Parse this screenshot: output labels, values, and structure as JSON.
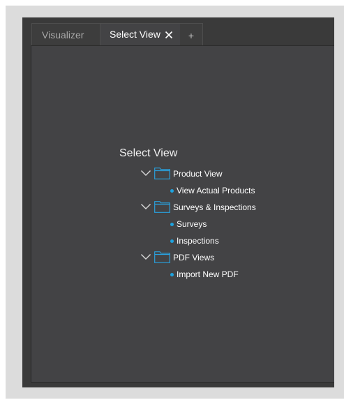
{
  "tabs": [
    {
      "label": "Visualizer",
      "active": false
    },
    {
      "label": "Select View",
      "active": true,
      "closable": true
    }
  ],
  "add_tab_label": "+",
  "panel": {
    "title": "Select View",
    "groups": [
      {
        "label": "Product View",
        "expanded": true,
        "icon": "folder-icon",
        "items": [
          "View Actual Products"
        ]
      },
      {
        "label": "Surveys & Inspections",
        "expanded": true,
        "icon": "folder-icon",
        "items": [
          "Surveys",
          "Inspections"
        ]
      },
      {
        "label": "PDF Views",
        "expanded": true,
        "icon": "folder-icon",
        "items": [
          "Import New PDF"
        ]
      }
    ]
  },
  "colors": {
    "accent": "#1fa3de",
    "background": "#434345",
    "text": "#ffffff"
  }
}
